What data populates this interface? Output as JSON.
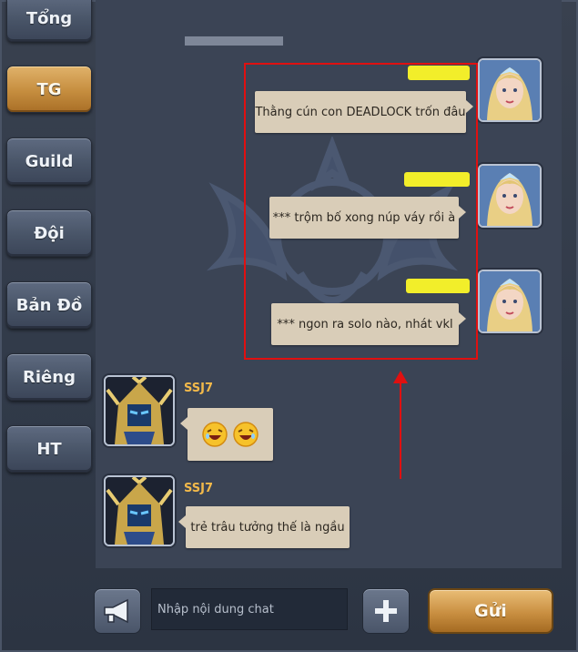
{
  "tabs": [
    {
      "label": "Tổng",
      "active": false
    },
    {
      "label": "TG",
      "active": true
    },
    {
      "label": "Guild",
      "active": false
    },
    {
      "label": "Đội",
      "active": false
    },
    {
      "label": "Bản Đồ",
      "active": false
    },
    {
      "label": "Riêng",
      "active": false
    },
    {
      "label": "HT",
      "active": false
    }
  ],
  "messages": [
    {
      "side": "right",
      "sender_hidden": true,
      "text": "Thằng cún con DEADLOCK trốn đâu",
      "avatar": "female-elf-avatar"
    },
    {
      "side": "right",
      "sender_hidden": true,
      "text": "*** trộm bố xong núp váy rồi à",
      "avatar": "female-elf-avatar"
    },
    {
      "side": "right",
      "sender_hidden": true,
      "text": "*** ngon ra solo nào, nhát vkl",
      "avatar": "female-elf-avatar"
    },
    {
      "side": "left",
      "sender": "SSJ7",
      "text": "",
      "emoji": [
        "laughing-emoji",
        "laughing-emoji"
      ],
      "avatar": "golden-armor-avatar"
    },
    {
      "side": "left",
      "sender": "SSJ7",
      "text": "trẻ trâu tưởng thế là ngầu",
      "avatar": "golden-armor-avatar"
    }
  ],
  "annotation": {
    "box_color": "#e01010",
    "arrow_color": "#e01010"
  },
  "input": {
    "placeholder": "Nhập nội dung chat",
    "value": ""
  },
  "send_label": "Gửi",
  "colors": {
    "accent_gold": "#c98f41",
    "highlight_yellow": "#f2ee2a",
    "sender_name": "#f2b94a",
    "bubble": "#d9cdb8"
  }
}
